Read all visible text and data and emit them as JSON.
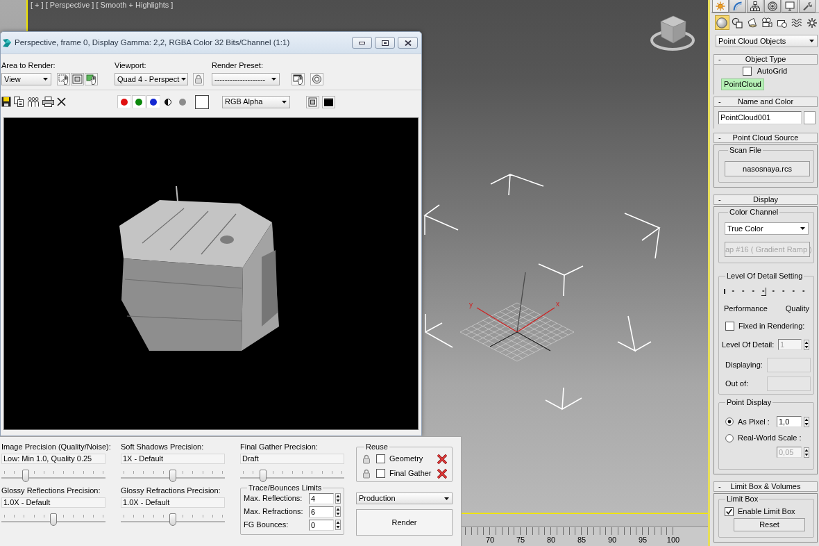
{
  "viewport": {
    "label": "[ + ] [ Perspective ] [ Smooth + Highlights ]",
    "axis_labels": {
      "x": "x",
      "y": "y"
    }
  },
  "render_window": {
    "title": "Perspective, frame 0, Display Gamma: 2,2, RGBA Color 32 Bits/Channel (1:1)",
    "area_to_render": {
      "label": "Area to Render:",
      "value": "View"
    },
    "viewport_select": {
      "label": "Viewport:",
      "value": "Quad 4 - Perspect"
    },
    "render_preset": {
      "label": "Render Preset:",
      "value": "--------------------"
    },
    "channel_buttons": [
      {
        "kind": "dot",
        "color": "#e01010",
        "on": true
      },
      {
        "kind": "dot",
        "color": "#0a870a",
        "on": true
      },
      {
        "kind": "dot",
        "color": "#1428d2",
        "on": true
      },
      {
        "kind": "alpha",
        "on": false
      },
      {
        "kind": "dot",
        "color": "#8c8c8c",
        "on": false
      }
    ],
    "display_channel": "RGB Alpha"
  },
  "render_settings": {
    "sliders": [
      {
        "label": "Image Precision (Quality/Noise):",
        "value": "Low: Min 1.0, Quality 0.25",
        "level": 0.23
      },
      {
        "label": "Soft Shadows Precision:",
        "value": "1X - Default",
        "level": 0.5
      },
      {
        "label": "Final Gather Precision:",
        "value": "Draft",
        "level": 0.22
      },
      {
        "label": "Glossy Reflections Precision:",
        "value": "1.0X - Default",
        "level": 0.5
      },
      {
        "label": "Glossy Refractions Precision:",
        "value": "1.0X - Default",
        "level": 0.5
      }
    ],
    "trace_limits": {
      "title": "Trace/Bounces Limits",
      "spinners": [
        {
          "label": "Max. Reflections:",
          "value": "4"
        },
        {
          "label": "Max. Refractions:",
          "value": "6"
        },
        {
          "label": "FG Bounces:",
          "value": "0"
        }
      ]
    },
    "reuse": {
      "title": "Reuse",
      "items": [
        {
          "label": "Geometry",
          "checked": false
        },
        {
          "label": "Final Gather",
          "checked": false
        }
      ]
    },
    "preset": "Production",
    "render_button": "Render"
  },
  "timeline": {
    "frame_labels": [
      "70",
      "75",
      "80",
      "85",
      "90",
      "95",
      "100"
    ]
  },
  "command_panel": {
    "tabs": [
      {
        "kind": "create",
        "selected": true
      },
      {
        "kind": "modify",
        "selected": false
      },
      {
        "kind": "hierarchy",
        "selected": false
      },
      {
        "kind": "motion",
        "selected": false
      },
      {
        "kind": "display",
        "selected": false
      },
      {
        "kind": "utilities",
        "selected": false
      }
    ],
    "categories": [
      {
        "kind": "geometry",
        "selected": true
      },
      {
        "kind": "shapes",
        "selected": false
      },
      {
        "kind": "lights",
        "selected": false
      },
      {
        "kind": "cameras",
        "selected": false
      },
      {
        "kind": "helpers",
        "selected": false
      },
      {
        "kind": "space_warps",
        "selected": false
      },
      {
        "kind": "systems",
        "selected": false
      }
    ],
    "object_category": "Point Cloud Objects",
    "object_type": {
      "toggle": "-",
      "title": "Object Type",
      "autogrid": {
        "label": "AutoGrid",
        "checked": false
      },
      "object_buttons": [
        {
          "label": "PointCloud",
          "selected": true
        }
      ]
    },
    "name_and_color": {
      "toggle": "-",
      "title": "Name and Color",
      "name": "PointCloud001"
    },
    "point_cloud_source": {
      "toggle": "-",
      "title": "Point Cloud Source",
      "group": "Scan File",
      "file_button": "nasosnaya.rcs"
    },
    "display": {
      "toggle": "-",
      "title": "Display",
      "color_channel": {
        "group": "Color Channel",
        "value": "True Color",
        "map_button": {
          "label": "ap #16 ( Gradient Ramp )",
          "disabled": true
        }
      },
      "level_of_detail": {
        "group": "Level Of Detail Setting",
        "level": 0.5,
        "min_label": "Performance",
        "max_label": "Quality",
        "fixed": {
          "label": "Fixed in Rendering:",
          "checked": false
        },
        "detail": {
          "label": "Level Of Detail:",
          "value": "1"
        },
        "displaying_label": "Displaying:",
        "out_of_label": "Out of:"
      },
      "point_display": {
        "group": "Point Display",
        "options": [
          {
            "label": "As Pixel :",
            "selected": true,
            "value": "1,0"
          },
          {
            "label": "Real-World Scale :",
            "selected": false,
            "value": "0,05"
          }
        ]
      }
    },
    "limit_box": {
      "toggle": "-",
      "title": "Limit Box & Volumes",
      "group": "Limit Box",
      "enable": {
        "label": "Enable Limit Box",
        "checked": true
      },
      "reset_button": "Reset"
    }
  }
}
